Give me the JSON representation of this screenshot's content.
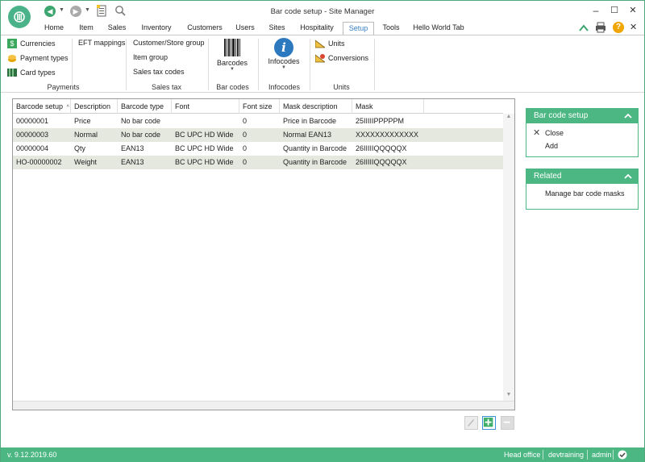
{
  "window": {
    "title": "Bar code setup - Site Manager",
    "minimize": "–",
    "maximize": "☐",
    "close": "✕"
  },
  "tabs": [
    "Home",
    "Item",
    "Sales",
    "Inventory",
    "Customers",
    "Users",
    "Sites",
    "Hospitality",
    "Setup",
    "Tools",
    "Hello World Tab"
  ],
  "active_tab": "Setup",
  "ribbon": {
    "payments": {
      "items": [
        "Currencies",
        "Payment types",
        "Card types"
      ],
      "label": "Payments"
    },
    "eft": {
      "items": [
        "EFT mappings"
      ]
    },
    "sales_tax": {
      "items": [
        "Customer/Store group",
        "Item group",
        "Sales tax codes"
      ],
      "label": "Sales tax"
    },
    "bar_codes": {
      "button": "Barcodes",
      "label": "Bar codes"
    },
    "infocodes": {
      "button": "Infocodes",
      "label": "Infocodes"
    },
    "units": {
      "items": [
        "Units",
        "Conversions"
      ],
      "label": "Units"
    }
  },
  "grid": {
    "columns": [
      "Barcode setup",
      "Description",
      "Barcode type",
      "Font",
      "Font size",
      "Mask description",
      "Mask"
    ],
    "sort_indicator": "^",
    "rows": [
      [
        "00000001",
        "Price",
        "No bar code",
        "",
        "0",
        "Price in Barcode",
        "25IIIIIPPPPPM"
      ],
      [
        "00000003",
        "Normal",
        "No bar code",
        "BC UPC HD Wide",
        "0",
        "Normal EAN13",
        "XXXXXXXXXXXXX"
      ],
      [
        "00000004",
        "Qty",
        "EAN13",
        "BC UPC HD Wide",
        "0",
        "Quantity in Barcode",
        "26IIIIIQQQQQX"
      ],
      [
        "HO-00000002",
        "Weight",
        "EAN13",
        "BC UPC HD Wide",
        "0",
        "Quantity in Barcode",
        "26IIIIIQQQQQX"
      ]
    ]
  },
  "panels": {
    "barcode_setup": {
      "title": "Bar code setup",
      "items": [
        "Close",
        "Add"
      ]
    },
    "related": {
      "title": "Related",
      "items": [
        "Manage bar code masks"
      ]
    }
  },
  "status": {
    "version": "v. 9.12.2019.60",
    "office": "Head office",
    "database": "devtraining",
    "user": "admin"
  },
  "colors": {
    "accent": "#4cb783",
    "active_tab_text": "#3a7fc4",
    "row_alt": "#e5e8df"
  }
}
